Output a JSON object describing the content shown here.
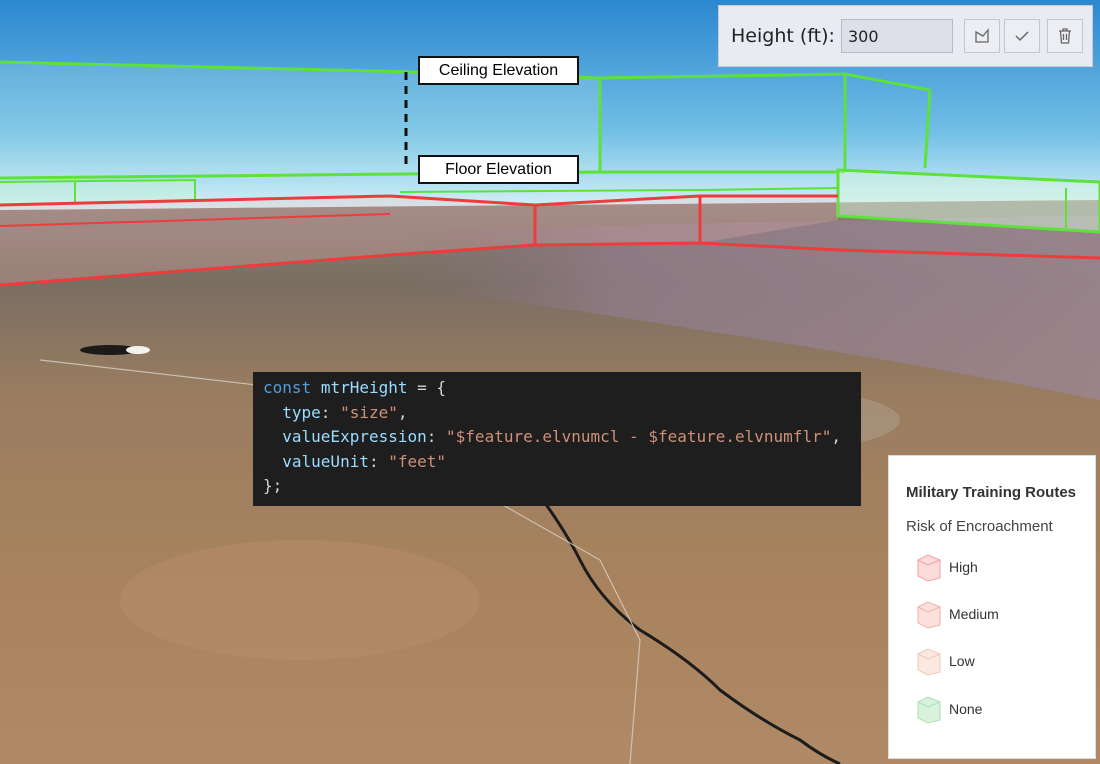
{
  "toolbar": {
    "height_label": "Height (ft):",
    "height_value": "300",
    "buttons": [
      {
        "icon": "draw-polygon-icon"
      },
      {
        "icon": "checkmark-icon"
      },
      {
        "icon": "trash-icon"
      }
    ]
  },
  "callouts": {
    "ceiling": "Ceiling Elevation",
    "floor": "Floor Elevation"
  },
  "code": {
    "line1_kw": "const",
    "line1_var": "mtrHeight",
    "line1_rest": " = {",
    "line2_prop": "type",
    "line2_val": "\"size\"",
    "line3_prop": "valueExpression",
    "line3_val": "\"$feature.elvnumcl - $feature.elvnumflr\"",
    "line4_prop": "valueUnit",
    "line4_val": "\"feet\"",
    "line5": "};"
  },
  "legend": {
    "title": "Military Training Routes",
    "subtitle": "Risk of Encroachment",
    "items": [
      {
        "label": "High",
        "color": "#f4a3a3"
      },
      {
        "label": "Medium",
        "color": "#f4b1a6"
      },
      {
        "label": "Low",
        "color": "#f4c8b4"
      },
      {
        "label": "None",
        "color": "#a9e2b3"
      }
    ]
  },
  "colors": {
    "route_green": "#5ce23a",
    "route_red": "#ee3b3b",
    "sky_top": "#2f8fd3",
    "ground": "#a07d5c"
  }
}
